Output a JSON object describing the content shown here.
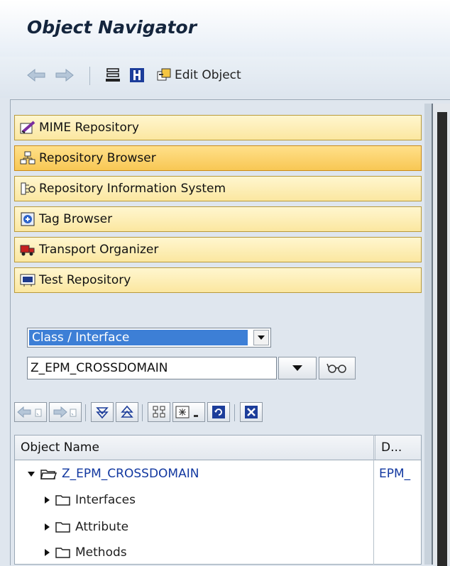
{
  "window": {
    "title": "Object Navigator"
  },
  "toolbar": {
    "back_icon": "back-arrow-icon",
    "forward_icon": "forward-arrow-icon",
    "hierarchy_icon": "hierarchy-icon",
    "info_icon": "info-icon",
    "edit_label": "Edit Object"
  },
  "tools": [
    {
      "label": "MIME Repository",
      "icon": "mime-icon",
      "active": false
    },
    {
      "label": "Repository Browser",
      "icon": "repository-browser-icon",
      "active": true
    },
    {
      "label": "Repository Information System",
      "icon": "info-system-icon",
      "active": false
    },
    {
      "label": "Tag Browser",
      "icon": "tag-icon",
      "active": false
    },
    {
      "label": "Transport Organizer",
      "icon": "truck-icon",
      "active": false
    },
    {
      "label": "Test Repository",
      "icon": "test-icon",
      "active": false
    }
  ],
  "object_type": {
    "selected": "Class / Interface"
  },
  "object_name": {
    "value": "Z_EPM_CROSSDOMAIN"
  },
  "tree": {
    "columns": [
      "Object Name",
      "D..."
    ],
    "rows": [
      {
        "label": "Z_EPM_CROSSDOMAIN",
        "desc": "EPM_",
        "expanded": true,
        "level": 0
      },
      {
        "label": "Interfaces",
        "expanded": false,
        "level": 1
      },
      {
        "label": "Attribute",
        "expanded": false,
        "level": 1
      },
      {
        "label": "Methods",
        "expanded": false,
        "level": 1
      }
    ]
  },
  "colors": {
    "accent_active": "#f8c754",
    "tool_bg": "#fbe7a0",
    "selection": "#3d7fd6",
    "link": "#1238a0"
  }
}
